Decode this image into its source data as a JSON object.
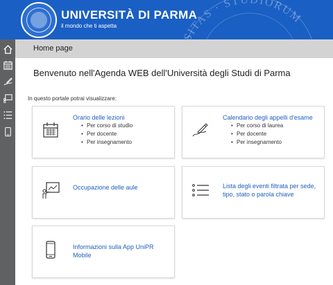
{
  "header": {
    "title": "UNIVERSITÀ DI PARMA",
    "subtitle": "il mondo che ti aspetta",
    "watermark": "· STUDIORUM",
    "watermark_prefix": "SITAS",
    "bg_color": "#1a5fc4"
  },
  "sidebar": {
    "items": [
      {
        "icon": "home-icon"
      },
      {
        "icon": "calendar-icon"
      },
      {
        "icon": "signature-icon"
      },
      {
        "icon": "classroom-icon"
      },
      {
        "icon": "list-icon"
      },
      {
        "icon": "mobile-icon"
      }
    ]
  },
  "breadcrumb": {
    "label": "Home page"
  },
  "main": {
    "welcome": "Benvenuto nell'Agenda WEB dell'Università  degli Studi di Parma",
    "intro": "In questo portale potrai visualizzare:"
  },
  "cards": [
    {
      "title": "Orario delle lezioni",
      "icon": "calendar-icon",
      "items": [
        "Per corso di studio",
        "Per docente",
        "Per insegnamento"
      ]
    },
    {
      "title": "Calendario degli appelli d'esame",
      "icon": "signature-icon",
      "items": [
        "Per corso di laurea",
        "Per docente",
        "Per insegnamento"
      ]
    },
    {
      "title": "Occupazione delle aule",
      "icon": "classroom-icon",
      "items": []
    },
    {
      "title": "Lista degli eventi filtrata per sede, tipo, stato o parola chiave",
      "icon": "list-icon",
      "items": []
    },
    {
      "title": "Informazioni sulla App UniPR Mobile",
      "icon": "mobile-icon",
      "items": []
    }
  ],
  "colors": {
    "link": "#1f5fbf",
    "sidebar": "#5f6163",
    "breadcrumb_bg": "#d3d3d3"
  }
}
